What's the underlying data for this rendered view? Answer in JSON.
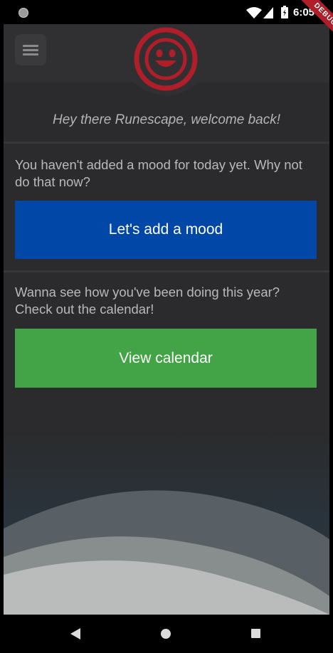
{
  "status_bar": {
    "time": "6:05",
    "icons": [
      "notification-dot-icon",
      "wifi-icon",
      "cell-signal-icon",
      "battery-icon"
    ]
  },
  "debug_banner": {
    "label": "DEBUG"
  },
  "app_bar": {
    "menu_icon": "hamburger-menu-icon",
    "logo_icon": "smiley-face-icon",
    "logo_color": "#b01e2a"
  },
  "welcome": {
    "text": "Hey there Runescape, welcome back!"
  },
  "mood_card": {
    "message": "You haven't added a mood for today yet.  Why not do that now?",
    "button_label": "Let's add a mood",
    "button_color": "#0047a8"
  },
  "calendar_card": {
    "message": "Wanna see how you've been doing this year? Check out the calendar!",
    "button_label": "View calendar",
    "button_color": "#43a447"
  },
  "nav_bar": {
    "icons": [
      "back-icon",
      "home-icon",
      "recents-icon"
    ]
  }
}
